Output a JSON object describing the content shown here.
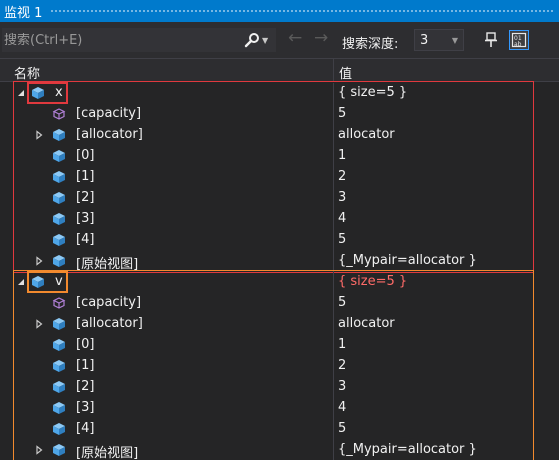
{
  "window": {
    "title": "监视 1"
  },
  "toolbar": {
    "search_placeholder": "搜索(Ctrl+E)",
    "depth_label": "搜索深度:",
    "depth_value": "3"
  },
  "columns": {
    "name": "名称",
    "value": "值"
  },
  "colors": {
    "accent": "#007acc",
    "box_x": "#e0393e",
    "box_v": "#f28a2e",
    "changed_value": "#ff6b68",
    "cube": "#4fa6e8",
    "field_icon": "#b180d7"
  },
  "watches": [
    {
      "name": "x",
      "value": "{ size=5 }",
      "expanded": true,
      "children": [
        {
          "name": "[capacity]",
          "value": "5",
          "icon": "field-icon",
          "expandable": false
        },
        {
          "name": "[allocator]",
          "value": "allocator",
          "icon": "object-icon",
          "expandable": true
        },
        {
          "name": "[0]",
          "value": "1",
          "icon": "object-icon",
          "expandable": false
        },
        {
          "name": "[1]",
          "value": "2",
          "icon": "object-icon",
          "expandable": false
        },
        {
          "name": "[2]",
          "value": "3",
          "icon": "object-icon",
          "expandable": false
        },
        {
          "name": "[3]",
          "value": "4",
          "icon": "object-icon",
          "expandable": false
        },
        {
          "name": "[4]",
          "value": "5",
          "icon": "object-icon",
          "expandable": false
        },
        {
          "name": "[原始视图]",
          "value": "{_Mypair=allocator }",
          "icon": "object-icon",
          "expandable": true
        }
      ]
    },
    {
      "name": "v",
      "value": "{ size=5 }",
      "value_changed": true,
      "expanded": true,
      "children": [
        {
          "name": "[capacity]",
          "value": "5",
          "icon": "field-icon",
          "expandable": false
        },
        {
          "name": "[allocator]",
          "value": "allocator",
          "icon": "object-icon",
          "expandable": true
        },
        {
          "name": "[0]",
          "value": "1",
          "icon": "object-icon",
          "expandable": false
        },
        {
          "name": "[1]",
          "value": "2",
          "icon": "object-icon",
          "expandable": false
        },
        {
          "name": "[2]",
          "value": "3",
          "icon": "object-icon",
          "expandable": false
        },
        {
          "name": "[3]",
          "value": "4",
          "icon": "object-icon",
          "expandable": false
        },
        {
          "name": "[4]",
          "value": "5",
          "icon": "object-icon",
          "expandable": false
        },
        {
          "name": "[原始视图]",
          "value": "{_Mypair=allocator }",
          "icon": "object-icon",
          "expandable": true
        }
      ]
    }
  ]
}
